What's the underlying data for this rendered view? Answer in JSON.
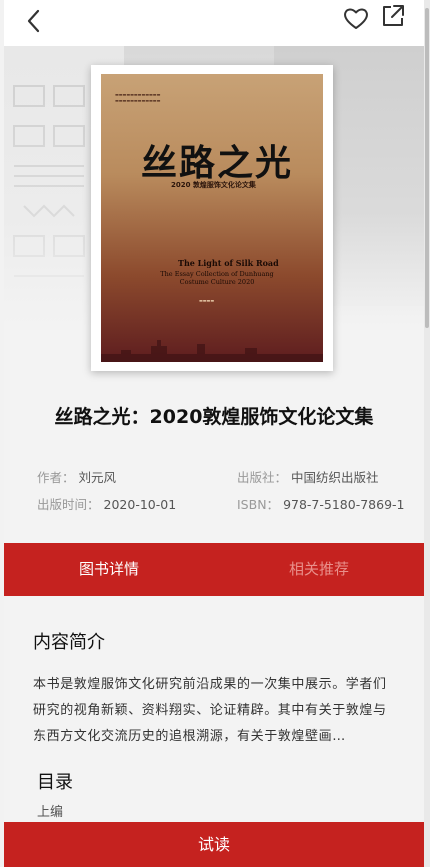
{
  "icons": {
    "back": "back-arrow-icon",
    "favorite": "heart-icon",
    "share": "share-icon"
  },
  "colors": {
    "accent": "#c5221f",
    "tab_inactive": "#e9908b"
  },
  "book": {
    "cover_title": "丝路之光",
    "cover_subtitle": "2020 敦煌服饰文化论文集",
    "cover_en_title": "The Light of Silk Road",
    "cover_en_subtitle": "The Essay Collection of Dunhuang Costume Culture 2020",
    "title": "丝路之光：2020敦煌服饰文化论文集",
    "author_label": "作者：",
    "author": "刘元风",
    "publisher_label": "出版社：",
    "publisher": "中国纺织出版社",
    "date_label": "出版时间：",
    "date": "2020-10-01",
    "isbn_label": "ISBN：",
    "isbn": "978-7-5180-7869-1"
  },
  "tabs": [
    {
      "label": "图书详情",
      "active": true
    },
    {
      "label": "相关推荐",
      "active": false
    }
  ],
  "intro": {
    "heading": "内容简介",
    "text": "本书是敦煌服饰文化研究前沿成果的一次集中展示。学者们研究的视角新颖、资料翔实、论证精辟。其中有关于敦煌与东西方文化交流历史的追根溯源，有关于敦煌壁画…"
  },
  "toc": {
    "heading": "目录",
    "items": [
      "上编"
    ]
  },
  "read_button": "试读"
}
